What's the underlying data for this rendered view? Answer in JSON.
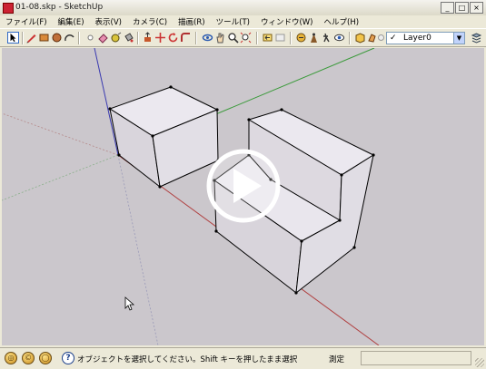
{
  "window": {
    "title": "01-08.skp - SketchUp",
    "controls": {
      "minimize": "_",
      "maximize": "□",
      "close": "×"
    }
  },
  "menu": {
    "items": [
      "ファイル(F)",
      "編集(E)",
      "表示(V)",
      "カメラ(C)",
      "描画(R)",
      "ツール(T)",
      "ウィンドウ(W)",
      "ヘルプ(H)"
    ]
  },
  "toolbar": {
    "layer_selected": "Layer0",
    "layer_check": "✓",
    "dropdown_arrow": "▼"
  },
  "status": {
    "message": "オブジェクトを選択してください。Shift キーを押したまま選択",
    "measurement_label": "測定",
    "measurement_value": "",
    "help_glyph": "?"
  },
  "colors": {
    "viewport_bg": "#cbc7cc",
    "face": "#e8e5ec",
    "edge": "#000000",
    "axis_red": "#b04040",
    "axis_green": "#3a9a3a",
    "axis_blue": "#3a3ab0",
    "accent": "#316ac5"
  }
}
